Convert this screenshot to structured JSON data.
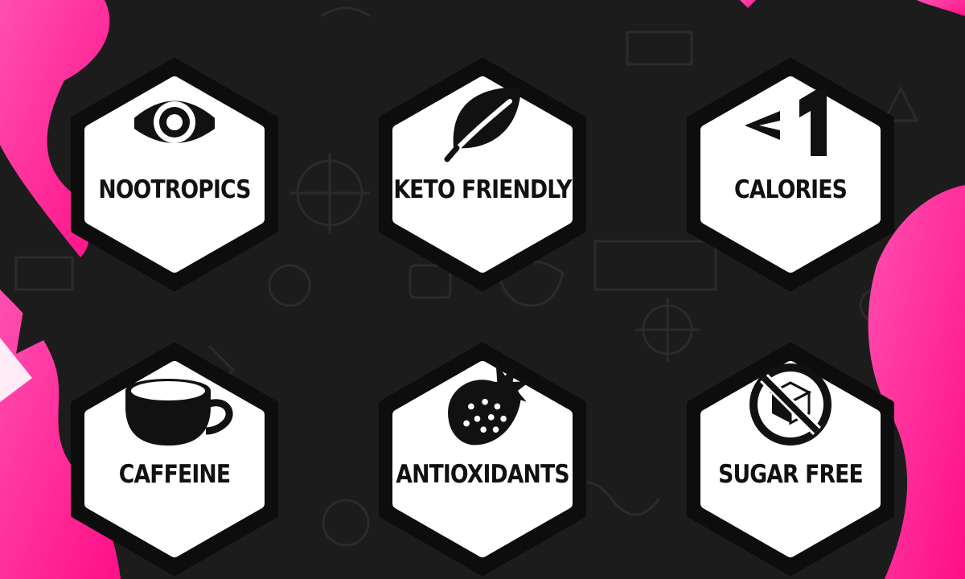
{
  "features": [
    {
      "label": "NOOTROPICS",
      "icon": "eye-icon"
    },
    {
      "label": "KETO FRIENDLY",
      "icon": "leaf-icon"
    },
    {
      "label": "CALORIES",
      "icon": "less-than-one-icon",
      "icon_text": "<1"
    },
    {
      "label": "CAFFEINE",
      "icon": "coffee-cup-icon"
    },
    {
      "label": "ANTIOXIDANTS",
      "icon": "strawberry-icon"
    },
    {
      "label": "SUGAR FREE",
      "icon": "no-sugar-cube-icon"
    }
  ],
  "colors": {
    "background": "#1c1c1c",
    "accent_pink": "#ff1a8c",
    "hex_border": "#0d0d0d",
    "hex_fill": "#ffffff",
    "text": "#111111"
  }
}
